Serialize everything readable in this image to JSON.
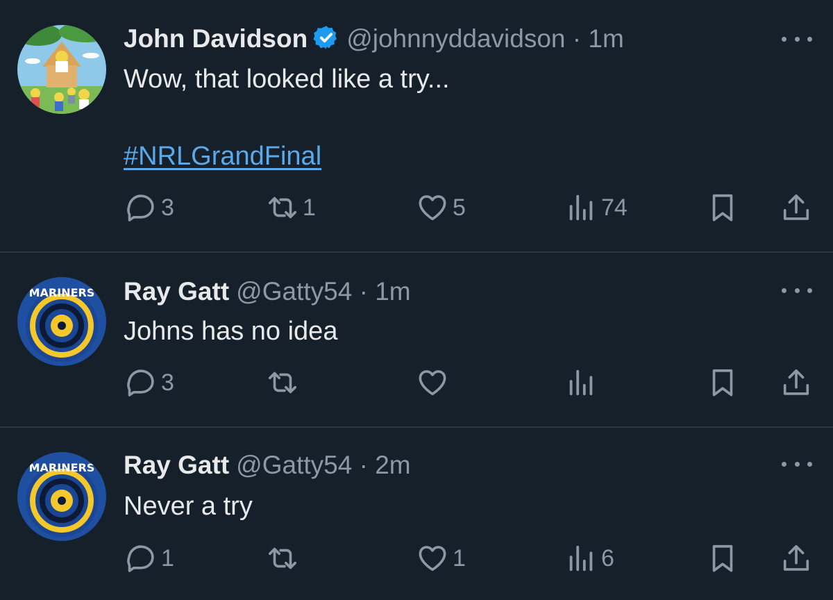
{
  "colors": {
    "background": "#16202a",
    "text_primary": "#e7e9ea",
    "text_secondary": "#8b98a5",
    "link": "#5aa9ea",
    "verified": "#1d9bf0"
  },
  "tweets": [
    {
      "display_name": "John Davidson",
      "verified": true,
      "handle": "@johnnyddavidson",
      "separator": "·",
      "time": "1m",
      "text": "Wow, that looked like a try...",
      "hashtag": "#NRLGrandFinal",
      "avatar_icon": "cartoon-avatar-icon",
      "replies": "3",
      "retweets": "1",
      "likes": "5",
      "views": "74"
    },
    {
      "display_name": "Ray Gatt",
      "verified": false,
      "handle": "@Gatty54",
      "separator": "·",
      "time": "1m",
      "text": "Johns has no idea",
      "avatar_icon": "mariners-logo-icon",
      "avatar_text": "MARINERS",
      "replies": "3",
      "retweets": "",
      "likes": "",
      "views": ""
    },
    {
      "display_name": "Ray Gatt",
      "verified": false,
      "handle": "@Gatty54",
      "separator": "·",
      "time": "2m",
      "text": "Never a try",
      "avatar_icon": "mariners-logo-icon",
      "avatar_text": "MARINERS",
      "replies": "1",
      "retweets": "",
      "likes": "1",
      "views": "6"
    }
  ],
  "icons": {
    "reply": "reply-icon",
    "retweet": "retweet-icon",
    "like": "heart-icon",
    "views": "views-icon",
    "bookmark": "bookmark-icon",
    "share": "share-icon",
    "more": "more-icon"
  }
}
